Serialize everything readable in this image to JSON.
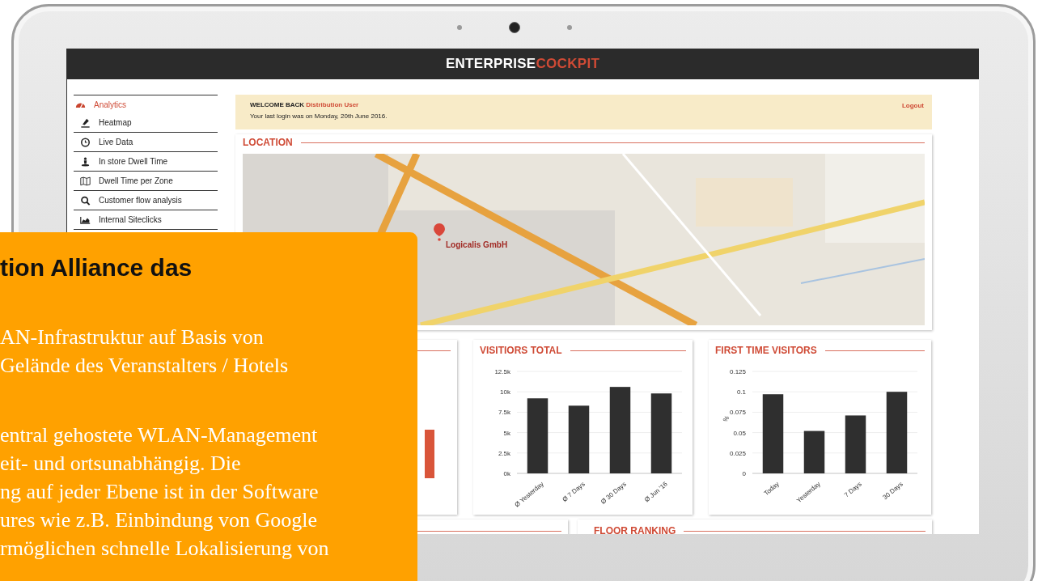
{
  "header": {
    "brand_first": "ENTERPRISE",
    "brand_second": "COCKPIT"
  },
  "sidebar": {
    "section": "Analytics",
    "items": [
      {
        "label": "Heatmap",
        "kind": "heatmap"
      },
      {
        "label": "Live Data",
        "kind": "clock"
      },
      {
        "label": "In store Dwell Time",
        "kind": "person"
      },
      {
        "label": "Dwell Time per Zone",
        "kind": "map"
      },
      {
        "label": "Customer flow analysis",
        "kind": "search"
      },
      {
        "label": "Internal Siteclicks",
        "kind": "area"
      }
    ]
  },
  "welcome": {
    "greeting": "WELCOME BACK",
    "user": "Distribution User",
    "last_login": "Your last login was on Monday, 20th June 2016.",
    "logout": "Logout"
  },
  "location": {
    "title": "LOCATION",
    "marker_label": "Logicalis GmbH"
  },
  "charts": [
    {
      "chart_data": {
        "type": "bar",
        "grid": true,
        "title": "VISITIORS TOTAL",
        "categories": [
          "Ø Yesterday",
          "Ø 7 Days",
          "Ø 30 Days",
          "Ø Jun '16"
        ],
        "values": [
          9200,
          8300,
          10600,
          9800
        ],
        "ylim": [
          0,
          12500
        ],
        "yticks": [
          {
            "value": 0,
            "label": "0k"
          },
          {
            "value": 2500,
            "label": "2.5k"
          },
          {
            "value": 5000,
            "label": "5k"
          },
          {
            "value": 7500,
            "label": "7.5k"
          },
          {
            "value": 10000,
            "label": "10k"
          },
          {
            "value": 12500,
            "label": "12.5k"
          }
        ]
      }
    },
    {
      "chart_data": {
        "type": "bar",
        "grid": true,
        "title": "FIRST TIME VISITORS",
        "ylabel": "%",
        "categories": [
          "Today",
          "Yesterday",
          "7 Days",
          "30 Days"
        ],
        "values": [
          0.097,
          0.052,
          0.071,
          0.1
        ],
        "ylim": [
          0,
          0.125
        ],
        "yticks": [
          0,
          0.025,
          0.05,
          0.075,
          0.1,
          0.125
        ]
      }
    }
  ],
  "floor_ranking": {
    "title": "FLOOR RANKING"
  },
  "overlay": {
    "title": "tion Alliance das",
    "paragraphs": [
      [
        "AN-Infrastruktur auf Basis von",
        "Gelände des Veranstalters / Hotels"
      ],
      [
        "entral gehostete WLAN-Management",
        "eit- und ortsunabhängig. Die",
        "ng auf jeder Ebene ist in der Software",
        "ures wie z.B. Einbindung von Google",
        "rmöglichen schnelle Lokalisierung von"
      ]
    ]
  }
}
